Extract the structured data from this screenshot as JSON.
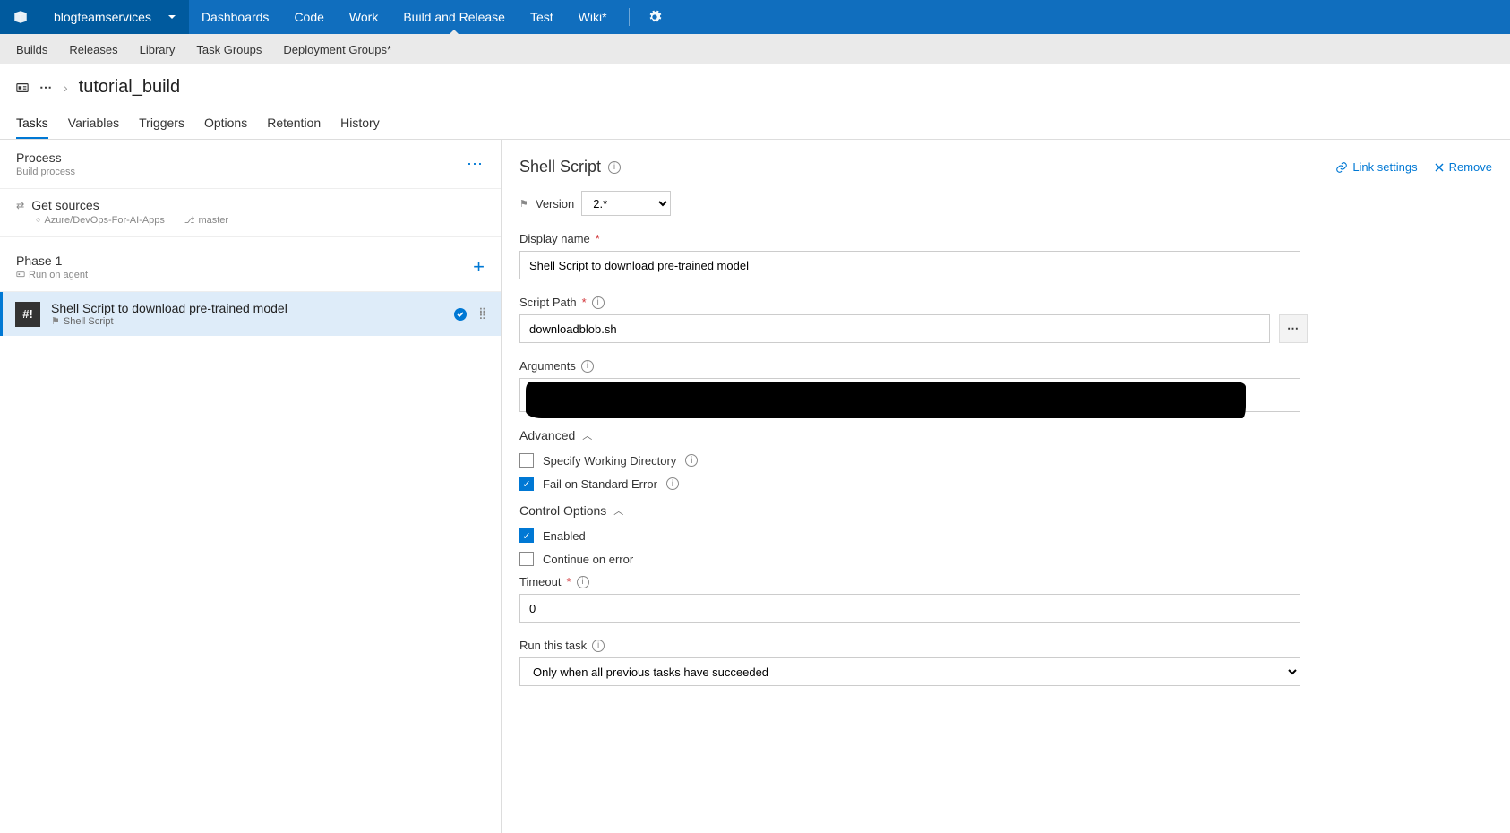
{
  "topnav": {
    "project": "blogteamservices",
    "tabs": [
      "Dashboards",
      "Code",
      "Work",
      "Build and Release",
      "Test",
      "Wiki*"
    ],
    "active_tab": "Build and Release"
  },
  "subnav": [
    "Builds",
    "Releases",
    "Library",
    "Task Groups",
    "Deployment Groups*"
  ],
  "breadcrumb": {
    "name": "tutorial_build"
  },
  "pagetabs": [
    "Tasks",
    "Variables",
    "Triggers",
    "Options",
    "Retention",
    "History"
  ],
  "pagetabs_active": "Tasks",
  "left": {
    "process": {
      "title": "Process",
      "sub": "Build process"
    },
    "sources": {
      "title": "Get sources",
      "repo": "Azure/DevOps-For-AI-Apps",
      "branch": "master"
    },
    "phase": {
      "title": "Phase 1",
      "sub": "Run on agent"
    },
    "task": {
      "title": "Shell Script to download pre-trained model",
      "sub": "Shell Script"
    }
  },
  "detail": {
    "header_title": "Shell Script",
    "link_settings": "Link settings",
    "remove": "Remove",
    "version_label": "Version",
    "version_value": "2.*",
    "display_name_label": "Display name",
    "display_name_value": "Shell Script to download pre-trained model",
    "script_path_label": "Script Path",
    "script_path_value": "downloadblob.sh",
    "arguments_label": "Arguments",
    "advanced_label": "Advanced",
    "adv_specify_wd": "Specify Working Directory",
    "adv_fail_stderr": "Fail on Standard Error",
    "control_options_label": "Control Options",
    "co_enabled": "Enabled",
    "co_continue": "Continue on error",
    "timeout_label": "Timeout",
    "timeout_value": "0",
    "run_task_label": "Run this task",
    "run_task_value": "Only when all previous tasks have succeeded"
  }
}
